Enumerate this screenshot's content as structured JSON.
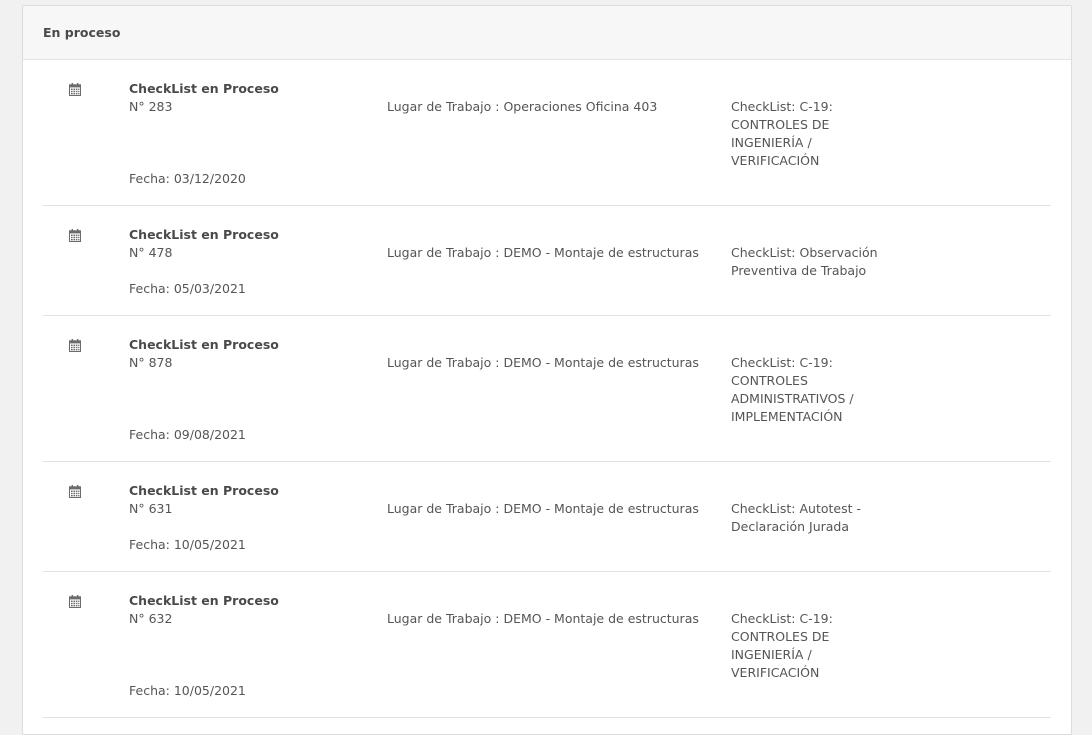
{
  "panel": {
    "title": "En proceso"
  },
  "items": [
    {
      "icon": "calendar-icon",
      "title": "CheckList en Proceso",
      "number": "N° 283",
      "place": "Lugar de Trabajo : Operaciones Oficina 403",
      "checklist_lines": [
        "CheckList: C-19:",
        "CONTROLES DE",
        "INGENIERÍA /",
        "VERIFICACIÓN"
      ],
      "date": "Fecha: 03/12/2020"
    },
    {
      "icon": "calendar-icon",
      "title": "CheckList en Proceso",
      "number": "N° 478",
      "place": "Lugar de Trabajo : DEMO - Montaje de estructuras",
      "checklist_lines": [
        "CheckList: Observación",
        "Preventiva de Trabajo"
      ],
      "date": "Fecha: 05/03/2021"
    },
    {
      "icon": "calendar-icon",
      "title": "CheckList en Proceso",
      "number": "N° 878",
      "place": "Lugar de Trabajo : DEMO - Montaje de estructuras",
      "checklist_lines": [
        "CheckList: C-19:",
        "CONTROLES",
        "ADMINISTRATIVOS /",
        "IMPLEMENTACIÓN"
      ],
      "date": "Fecha: 09/08/2021"
    },
    {
      "icon": "calendar-icon",
      "title": "CheckList en Proceso",
      "number": "N° 631",
      "place": "Lugar de Trabajo : DEMO - Montaje de estructuras",
      "checklist_lines": [
        "CheckList: Autotest -",
        "Declaración Jurada"
      ],
      "date": "Fecha: 10/05/2021"
    },
    {
      "icon": "calendar-icon",
      "title": "CheckList en Proceso",
      "number": "N° 632",
      "place": "Lugar de Trabajo : DEMO - Montaje de estructuras",
      "checklist_lines": [
        "CheckList: C-19:",
        "CONTROLES DE",
        "INGENIERÍA /",
        "VERIFICACIÓN"
      ],
      "date": "Fecha: 10/05/2021"
    }
  ]
}
